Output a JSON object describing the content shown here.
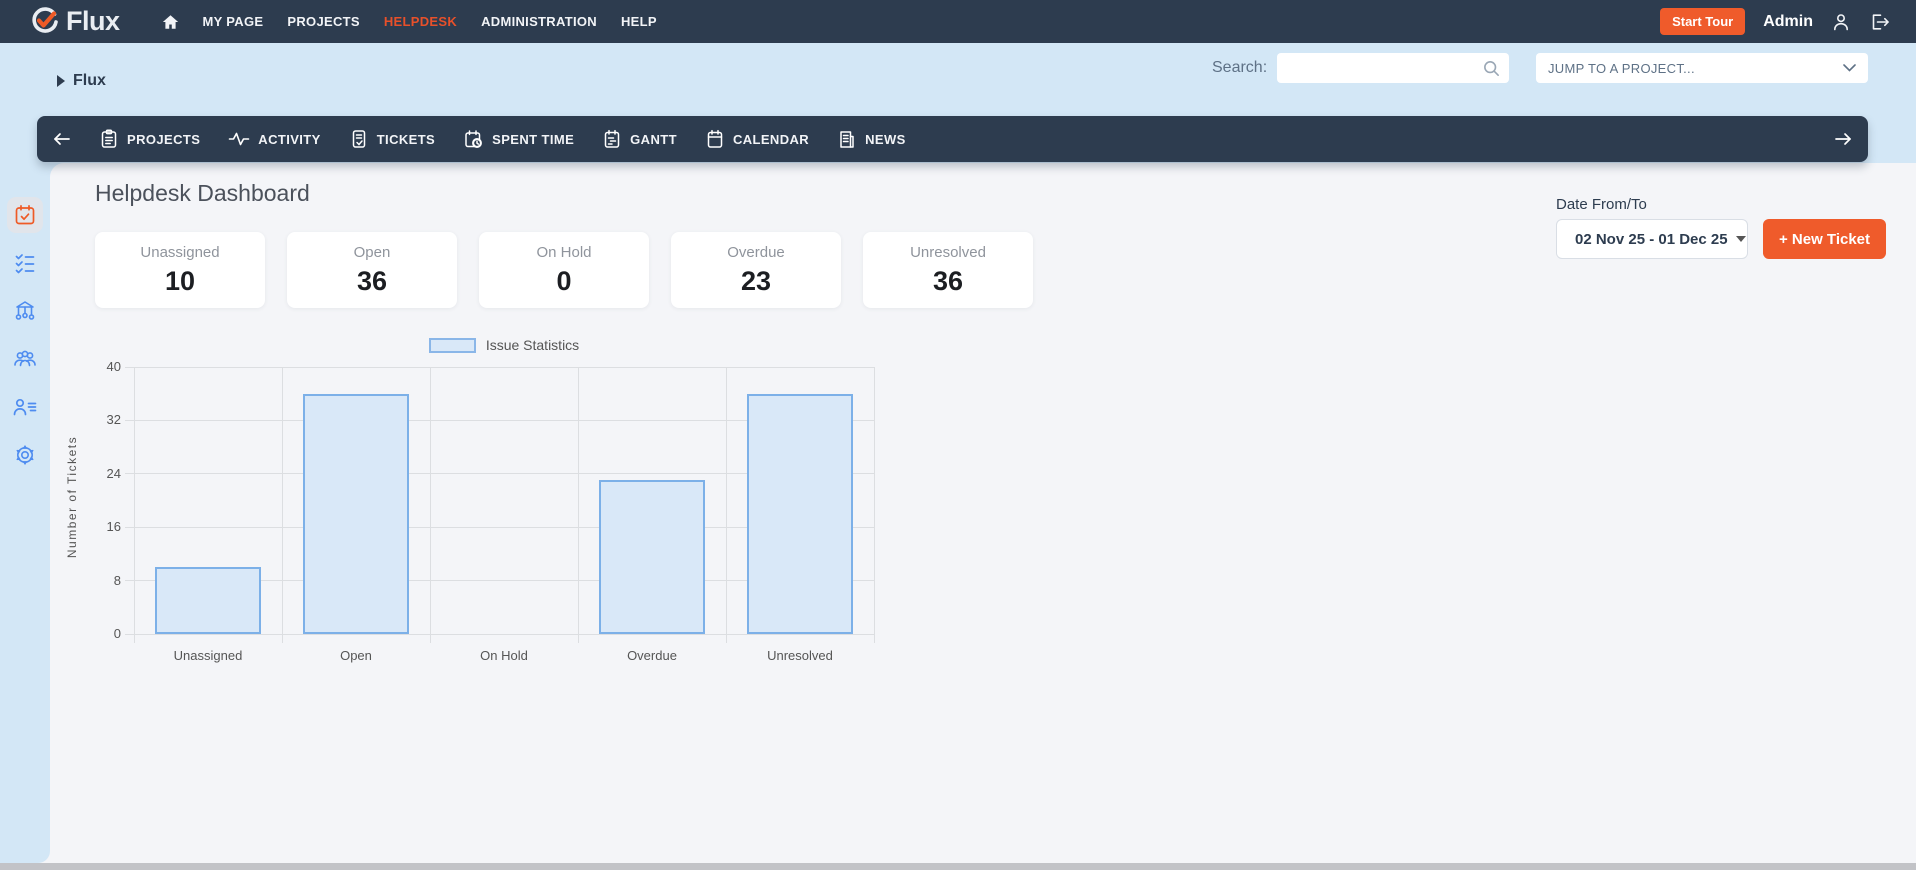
{
  "topbar": {
    "logo_text": "Flux",
    "nav": [
      {
        "label": "MY PAGE"
      },
      {
        "label": "PROJECTS"
      },
      {
        "label": "HELPDESK",
        "active": true
      },
      {
        "label": "ADMINISTRATION"
      },
      {
        "label": "HELP"
      }
    ],
    "start_tour_label": "Start Tour",
    "user_name": "Admin"
  },
  "subheader": {
    "breadcrumb": "Flux",
    "search_label": "Search:",
    "jump_placeholder": "JUMP TO A PROJECT..."
  },
  "toolbar": {
    "items": [
      {
        "label": "PROJECTS",
        "icon": "projects-icon"
      },
      {
        "label": "ACTIVITY",
        "icon": "activity-icon"
      },
      {
        "label": "TICKETS",
        "icon": "tickets-icon"
      },
      {
        "label": "SPENT TIME",
        "icon": "spent-time-icon"
      },
      {
        "label": "GANTT",
        "icon": "gantt-icon"
      },
      {
        "label": "CALENDAR",
        "icon": "calendar-icon"
      },
      {
        "label": "NEWS",
        "icon": "news-icon"
      }
    ]
  },
  "sidebar": {
    "items": [
      {
        "icon": "helpdesk-dashboard-icon",
        "active": true
      },
      {
        "icon": "tasks-icon"
      },
      {
        "icon": "hub-icon"
      },
      {
        "icon": "groups-icon"
      },
      {
        "icon": "contacts-icon"
      },
      {
        "icon": "settings-icon"
      }
    ]
  },
  "main": {
    "title": "Helpdesk Dashboard",
    "date_label": "Date From/To",
    "date_range": "02 Nov 25 - 01 Dec 25",
    "new_ticket_label": "+ New Ticket",
    "cards": [
      {
        "label": "Unassigned",
        "value": "10"
      },
      {
        "label": "Open",
        "value": "36"
      },
      {
        "label": "On Hold",
        "value": "0"
      },
      {
        "label": "Overdue",
        "value": "23"
      },
      {
        "label": "Unresolved",
        "value": "36"
      }
    ]
  },
  "chart_data": {
    "type": "bar",
    "legend": "Issue Statistics",
    "categories": [
      "Unassigned",
      "Open",
      "On Hold",
      "Overdue",
      "Unresolved"
    ],
    "values": [
      10,
      36,
      0,
      23,
      36
    ],
    "title": "",
    "xlabel": "",
    "ylabel": "Number of Tickets",
    "ylim": [
      0,
      40
    ],
    "yticks": [
      0,
      8,
      16,
      24,
      32,
      40
    ],
    "grid": true,
    "legend_position": "top-center",
    "bar_fill": "#d9e8f8",
    "bar_border": "#7cb0e8"
  },
  "colors": {
    "accent_orange": "#ef5b2b",
    "topbar_bg": "#2d3c4f",
    "band_blue": "#d3e7f6",
    "content_bg": "#f4f5f8",
    "sidebar_icon_blue": "#4e8cf0"
  }
}
